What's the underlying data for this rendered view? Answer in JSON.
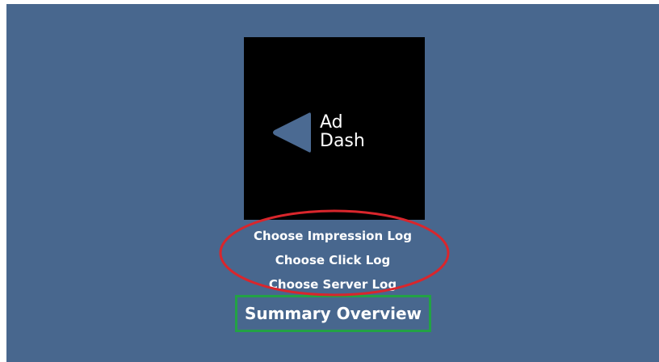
{
  "logo": {
    "line1": "Ad",
    "line2": "Dash",
    "icon": "triangle-play-icon"
  },
  "menu": {
    "impression_label": "Choose Impression Log",
    "click_label": "Choose Click Log",
    "server_label": "Choose Server Log"
  },
  "summary": {
    "label": "Summary Overview"
  },
  "colors": {
    "background": "#48678e",
    "logo_background": "#000000",
    "annotation_red": "#d9262c",
    "annotation_green": "#23a245",
    "logo_accent": "#4b6a92"
  }
}
